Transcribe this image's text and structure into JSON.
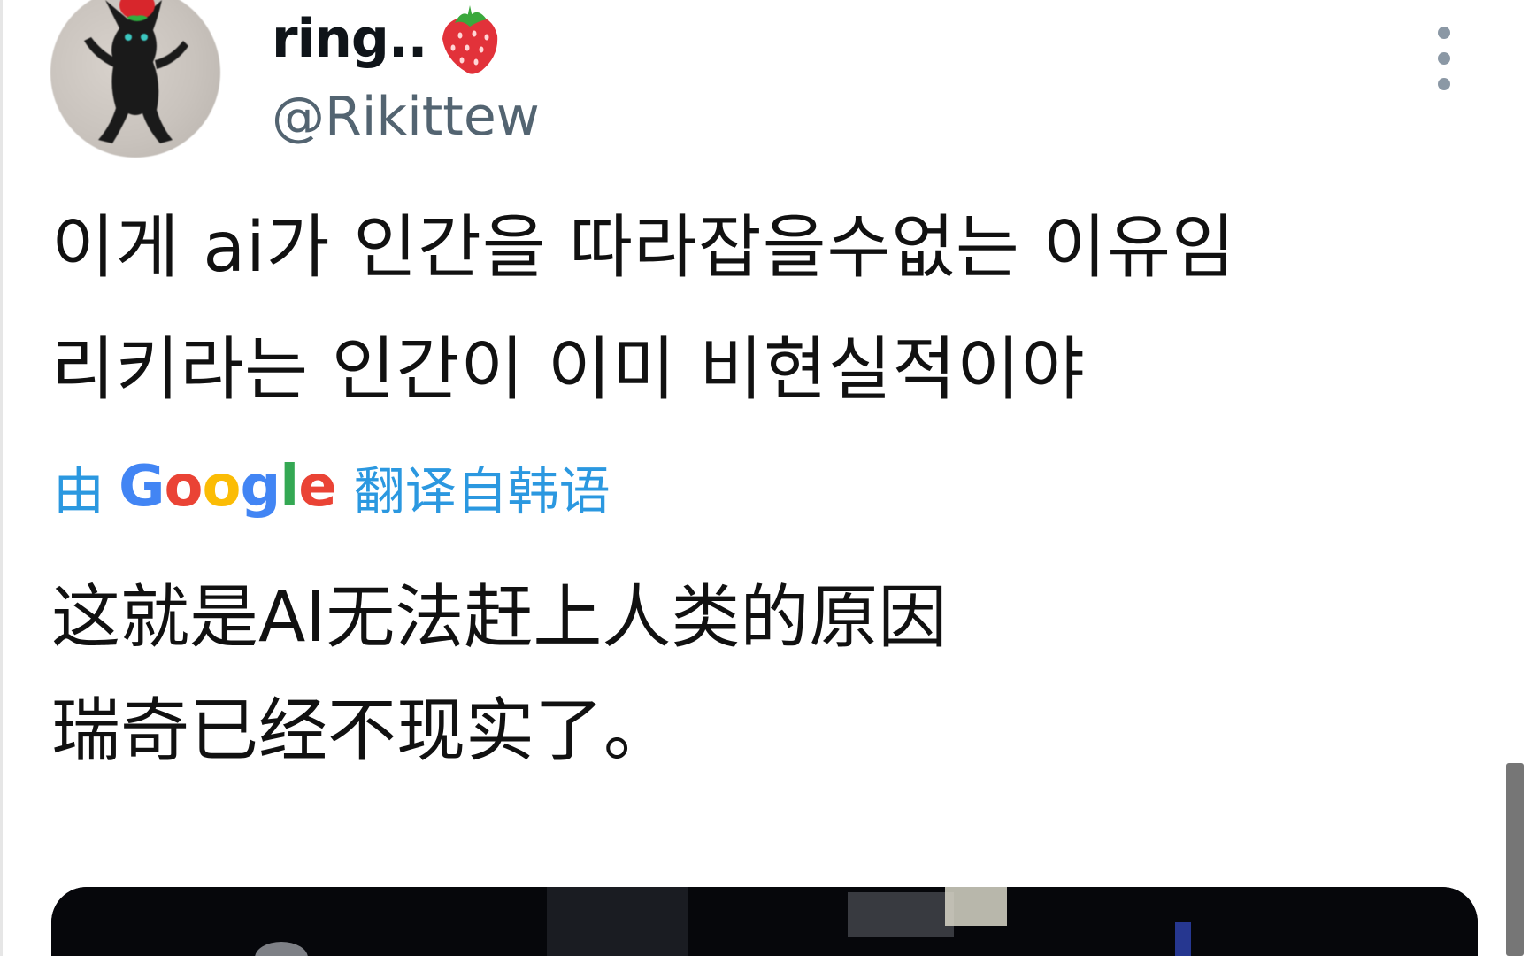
{
  "tweet": {
    "author": {
      "display_name": "ring..",
      "display_name_emoji": "strawberry-icon",
      "handle": "@Rikittew"
    },
    "text_lines": [
      "이게 ai가 인간을 따라잡을수없는 이유임",
      "리키라는 인간이 이미 비현실적이야"
    ],
    "translation": {
      "prefix": "由",
      "provider_letters": [
        "G",
        "o",
        "o",
        "g",
        "l",
        "e"
      ],
      "provider_colors": [
        "#4285f4",
        "#ea4335",
        "#fbbc05",
        "#4285f4",
        "#34a853",
        "#ea4335"
      ],
      "suffix": "翻译自韩语"
    },
    "translated_lines": [
      "这就是AI无法赶上人类的原因",
      "瑞奇已经不现实了。"
    ],
    "more_icon": "vertical-ellipsis-icon"
  },
  "colors": {
    "text": "#111111",
    "secondary": "#536471",
    "link": "#2b98e0"
  }
}
